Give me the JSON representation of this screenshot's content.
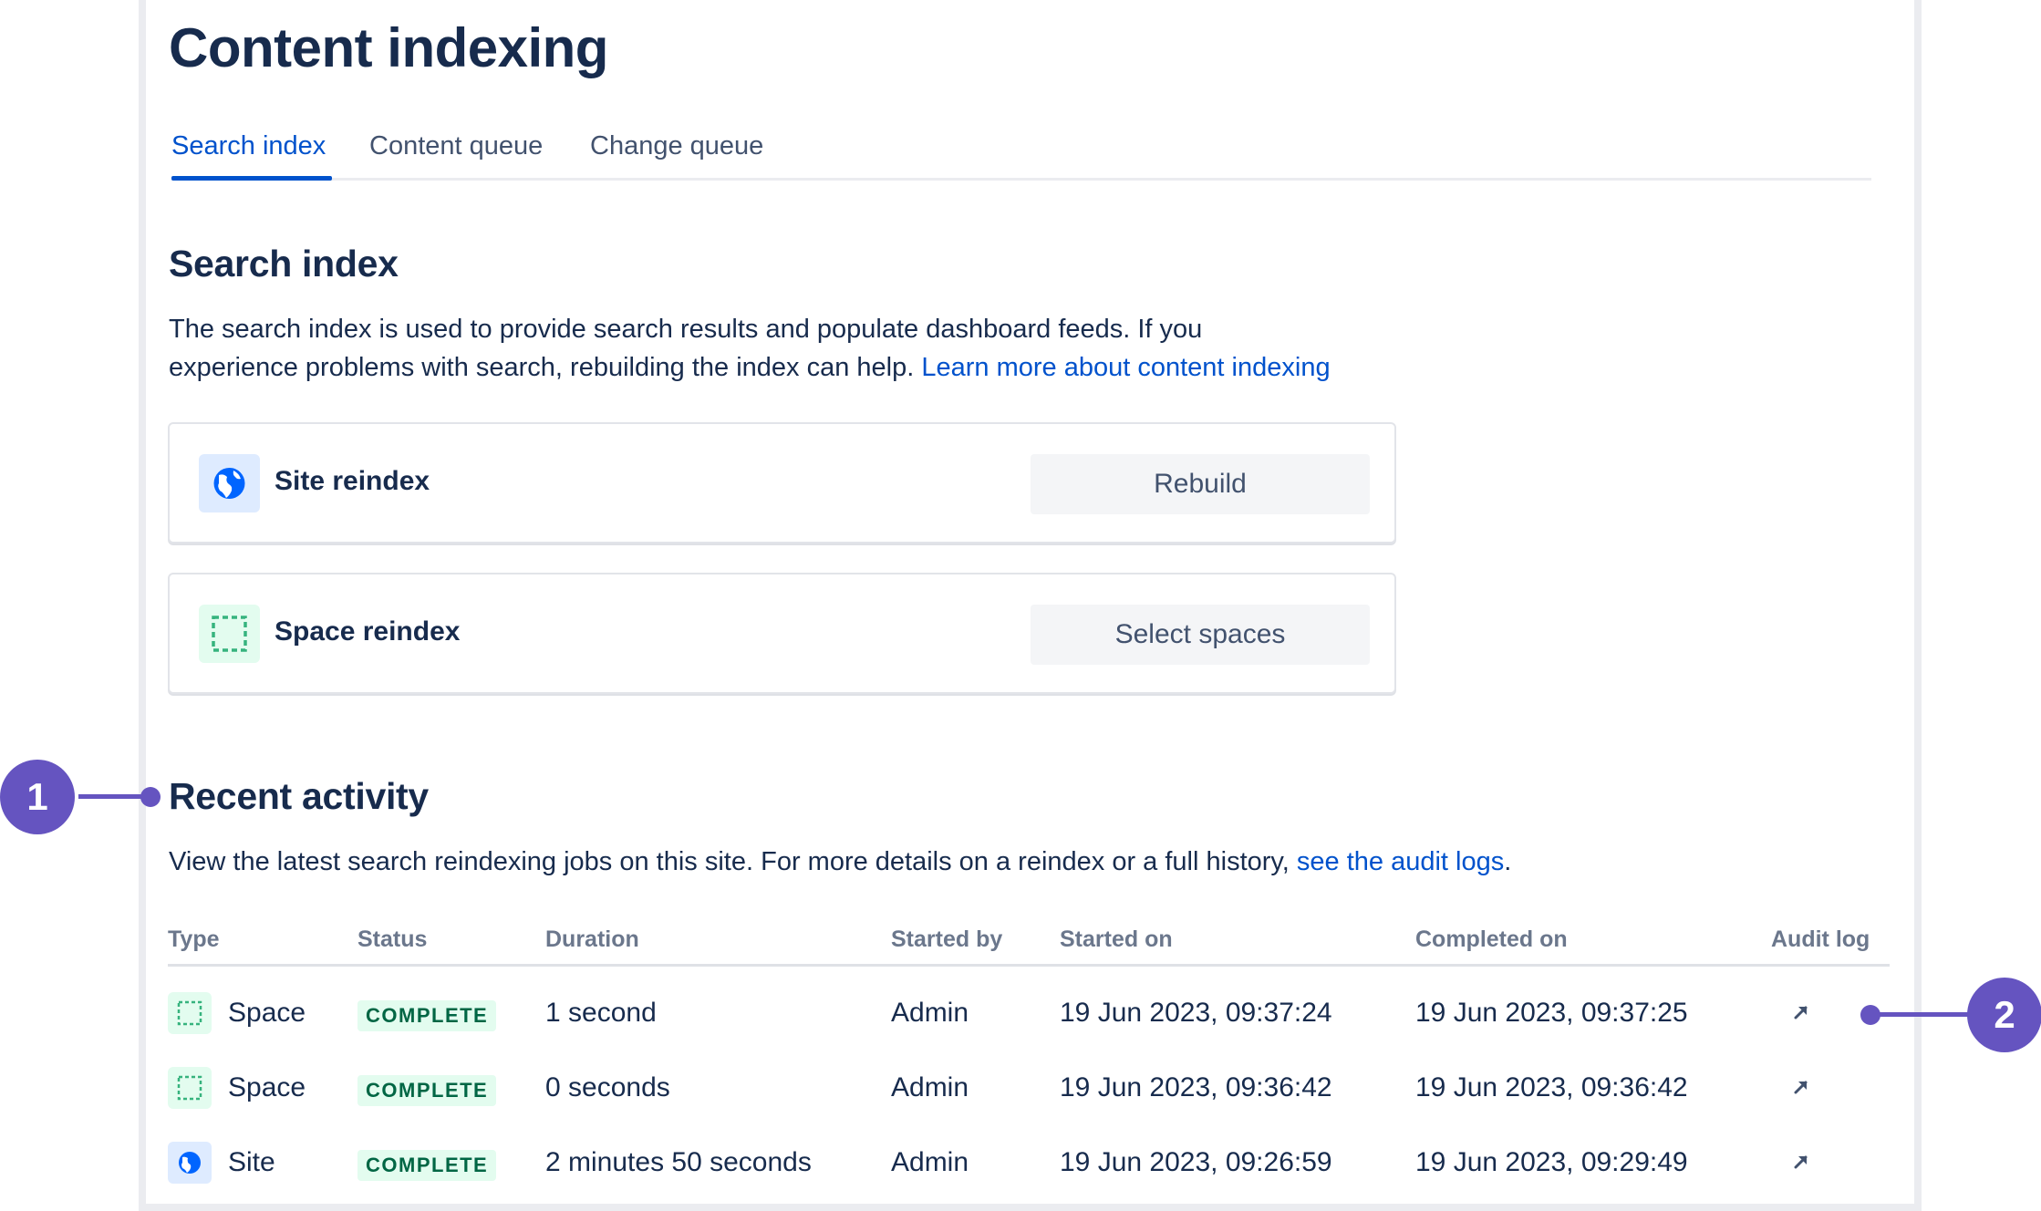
{
  "page": {
    "title": "Content indexing"
  },
  "tabs": [
    {
      "label": "Search index",
      "active": true
    },
    {
      "label": "Content queue",
      "active": false
    },
    {
      "label": "Change queue",
      "active": false
    }
  ],
  "search_index": {
    "heading": "Search index",
    "description_line1": "The search index is used to provide search results and populate dashboard feeds. If you",
    "description_line2": "experience problems with search, rebuilding the index can help.",
    "learn_more_link": "Learn more about content indexing"
  },
  "cards": {
    "site_reindex": {
      "label": "Site reindex",
      "button": "Rebuild",
      "icon": "globe-icon"
    },
    "space_reindex": {
      "label": "Space reindex",
      "button": "Select spaces",
      "icon": "space-icon"
    }
  },
  "recent_activity": {
    "heading": "Recent activity",
    "description": "View the latest search reindexing jobs on this site. For more details on a reindex or a full history,",
    "audit_link": "see the audit logs",
    "period": "."
  },
  "table": {
    "headers": [
      "Type",
      "Status",
      "Duration",
      "Started by",
      "Started on",
      "Completed on",
      "Audit log"
    ],
    "rows": [
      {
        "type": "Space",
        "icon": "space-icon",
        "status": "COMPLETE",
        "duration": "1 second",
        "started_by": "Admin",
        "started_on": "19 Jun 2023, 09:37:24",
        "completed_on": "19 Jun 2023, 09:37:25",
        "audit_icon": "arrow-up-right-icon"
      },
      {
        "type": "Space",
        "icon": "space-icon",
        "status": "COMPLETE",
        "duration": "0 seconds",
        "started_by": "Admin",
        "started_on": "19 Jun 2023, 09:36:42",
        "completed_on": "19 Jun 2023, 09:36:42",
        "audit_icon": "arrow-up-right-icon"
      },
      {
        "type": "Site",
        "icon": "globe-icon",
        "status": "COMPLETE",
        "duration": "2 minutes 50 seconds",
        "started_by": "Admin",
        "started_on": "19 Jun 2023, 09:26:59",
        "completed_on": "19 Jun 2023, 09:29:49",
        "audit_icon": "arrow-up-right-icon"
      }
    ]
  },
  "callouts": [
    {
      "number": "1"
    },
    {
      "number": "2"
    }
  ],
  "colors": {
    "primary_link": "#0052cc",
    "text": "#172b4d",
    "muted": "#6b778c",
    "lozenge_bg": "#e3fcef",
    "lozenge_text": "#006644",
    "callout": "#6554c0"
  }
}
